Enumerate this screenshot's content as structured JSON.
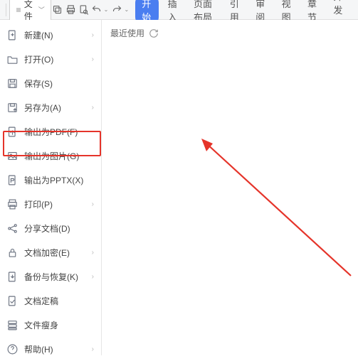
{
  "menubar": {
    "file_label": "文件",
    "tabs": [
      {
        "label": "开始",
        "active": true
      },
      {
        "label": "插入",
        "active": false
      },
      {
        "label": "页面布局",
        "active": false
      },
      {
        "label": "引用",
        "active": false
      },
      {
        "label": "审阅",
        "active": false
      },
      {
        "label": "视图",
        "active": false
      },
      {
        "label": "章节",
        "active": false
      },
      {
        "label": "开发工",
        "active": false
      }
    ]
  },
  "file_menu": {
    "items": [
      {
        "icon": "file-new-icon",
        "label": "新建(N)",
        "arrow": true
      },
      {
        "icon": "folder-open-icon",
        "label": "打开(O)",
        "arrow": true
      },
      {
        "icon": "save-icon",
        "label": "保存(S)",
        "arrow": false
      },
      {
        "icon": "save-as-icon",
        "label": "另存为(A)",
        "arrow": true
      },
      {
        "icon": "export-pdf-icon",
        "label": "输出为PDF(F)",
        "arrow": false
      },
      {
        "icon": "export-image-icon",
        "label": "输出为图片(G)",
        "arrow": false
      },
      {
        "icon": "export-pptx-icon",
        "label": "输出为PPTX(X)",
        "arrow": false
      },
      {
        "icon": "print-icon",
        "label": "打印(P)",
        "arrow": true
      },
      {
        "icon": "share-icon",
        "label": "分享文档(D)",
        "arrow": false
      },
      {
        "icon": "encrypt-icon",
        "label": "文档加密(E)",
        "arrow": true
      },
      {
        "icon": "backup-icon",
        "label": "备份与恢复(K)",
        "arrow": true
      },
      {
        "icon": "finalize-icon",
        "label": "文档定稿",
        "arrow": false
      },
      {
        "icon": "slim-icon",
        "label": "文件瘦身",
        "arrow": false
      },
      {
        "icon": "help-icon",
        "label": "帮助(H)",
        "arrow": true
      }
    ]
  },
  "right": {
    "recent_label": "最近使用"
  }
}
